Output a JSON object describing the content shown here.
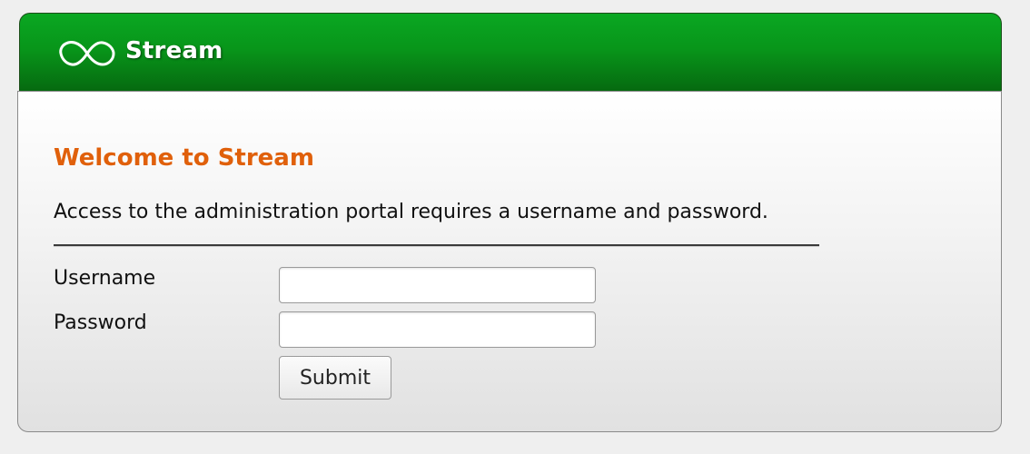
{
  "header": {
    "title": "Stream",
    "logo_icon": "infinity-icon",
    "colors": {
      "bar": "#08961a",
      "title": "#ffffff"
    }
  },
  "main": {
    "welcome_heading": "Welcome to Stream",
    "description": "Access to the administration portal requires a username and password.",
    "colors": {
      "heading": "#e0600b"
    }
  },
  "form": {
    "username_label": "Username",
    "username_value": "",
    "password_label": "Password",
    "password_value": "",
    "submit_label": "Submit"
  }
}
